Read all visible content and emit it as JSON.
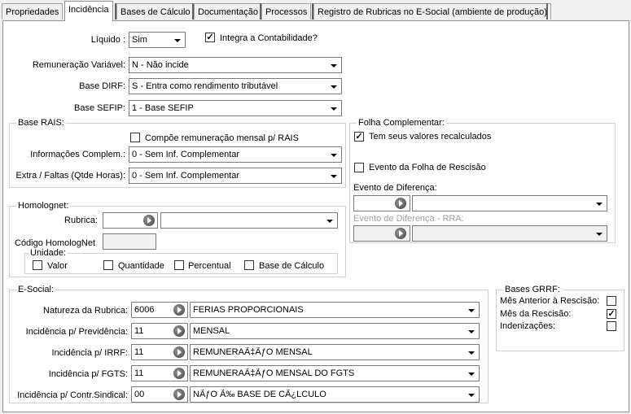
{
  "tabs": [
    {
      "label": "Propriedades"
    },
    {
      "label": "Incidência"
    },
    {
      "label": "Bases de Cálculo"
    },
    {
      "label": "Documentação"
    },
    {
      "label": "Processos"
    },
    {
      "label": "Registro de Rubricas no E-Social (ambiente de produção)"
    }
  ],
  "main": {
    "liquido": {
      "label": "Líquido :",
      "value": "Sim"
    },
    "integra": {
      "label": "Integra a Contabilidade?",
      "checked": true
    },
    "remuneracao": {
      "label": "Remuneração Variável:",
      "value": "N - Não incide"
    },
    "base_dirf": {
      "label": "Base DIRF:",
      "value": "S - Entra como rendimento tributável"
    },
    "base_sefip": {
      "label": "Base SEFIP:",
      "value": "1 - Base SEFIP"
    }
  },
  "rais": {
    "title": "Base RAIS:",
    "compoe": {
      "label": "Compõe remuneração mensal p/ RAIS",
      "checked": false
    },
    "info": {
      "label": "Informações Complem.:",
      "value": "0 - Sem Inf. Complementar"
    },
    "extra": {
      "label": "Extra / Faltas (Qtde Horas):",
      "value": "0 - Sem Inf. Complementar"
    }
  },
  "folha": {
    "title": "Folha Complementar:",
    "recalc": {
      "label": "Tem seus valores recalculados",
      "checked": true
    },
    "rescisao": {
      "label": "Evento da Folha de Rescisão",
      "checked": false
    },
    "diferenca": {
      "label": "Evento de Diferença:",
      "code": "",
      "value": ""
    },
    "diferenca_rra": {
      "label": "Evento de Diferença - RRA:",
      "code": "",
      "value": ""
    }
  },
  "homolog": {
    "title": "Homolognet:",
    "rubrica": {
      "label": "Rubrica:",
      "code": "",
      "value": ""
    },
    "codigo": {
      "label": "Código HomologNet",
      "value": ""
    },
    "unidade": {
      "title": "Unidade:",
      "options": [
        {
          "label": "Valor",
          "checked": false
        },
        {
          "label": "Quantidade",
          "checked": false
        },
        {
          "label": "Percentual",
          "checked": false
        },
        {
          "label": "Base de Cálculo",
          "checked": false
        }
      ]
    }
  },
  "esocial": {
    "title": "E-Social:",
    "rows": [
      {
        "label": "Natureza da Rubrica:",
        "code": "6006",
        "value": "FERIAS PROPORCIONAIS"
      },
      {
        "label": "Incidência p/ Previdência:",
        "code": "11",
        "value": "MENSAL"
      },
      {
        "label": "Incidência p/ IRRF:",
        "code": "11",
        "value": "REMUNERAÃ‡ÃƒO MENSAL"
      },
      {
        "label": "Incidência p/ FGTS:",
        "code": "11",
        "value": "REMUNERAÃ‡ÃƒO MENSAL DO FGTS"
      },
      {
        "label": "Incidência p/ Contr.Sindical:",
        "code": "00",
        "value": "NÃƒO Ã‰ BASE DE CÃ¿LCULO"
      }
    ]
  },
  "grrf": {
    "title": "Bases GRRF:",
    "items": [
      {
        "label": "Mês Anterior à Rescisão:",
        "checked": false
      },
      {
        "label": "Mês da Rescisão:",
        "checked": true
      },
      {
        "label": "Indenizações:",
        "checked": false
      }
    ]
  }
}
